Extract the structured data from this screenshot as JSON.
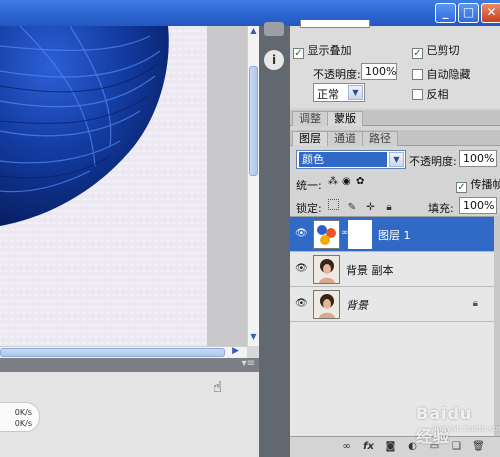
{
  "window": {
    "minimize_glyph": "_",
    "maximize_glyph": "□",
    "close_glyph": "✕"
  },
  "clipping": {
    "show_overlay_label": "显示叠加",
    "show_overlay_checked": true,
    "clip_label": "已剪切",
    "clip_checked": true,
    "opacity_label": "不透明度:",
    "opacity_value": "100%",
    "auto_hide_label": "自动隐藏",
    "auto_hide_checked": false,
    "mode_value": "正常",
    "invert_label": "反相",
    "invert_checked": false
  },
  "adjust_tabs": [
    "调整",
    "蒙版"
  ],
  "layer_tabs": [
    "图层",
    "通道",
    "路径"
  ],
  "layers_panel": {
    "blend_mode": "颜色",
    "opacity_label": "不透明度:",
    "opacity_value": "100%",
    "unify_label": "统一:",
    "propagate_label": "传播帧",
    "lock_label": "锁定:",
    "fill_label": "填充:",
    "fill_value": "100%"
  },
  "layers": [
    {
      "name": "图层 1",
      "selected": true,
      "has_mask": true,
      "italic": false,
      "locked": false
    },
    {
      "name": "背景 副本",
      "selected": false,
      "has_mask": false,
      "italic": false,
      "locked": false
    },
    {
      "name": "背景",
      "selected": false,
      "has_mask": false,
      "italic": true,
      "locked": true
    }
  ],
  "net_speed": {
    "up": "0K/s",
    "down": "0K/s"
  },
  "watermark": {
    "brand": "Baidu 经验",
    "url": "jingyan.baidu.com"
  },
  "colors": {
    "selection_blue": "#3169c6",
    "panel_gray": "#d4d4d4",
    "hair_blue": "#0c2a8a"
  }
}
